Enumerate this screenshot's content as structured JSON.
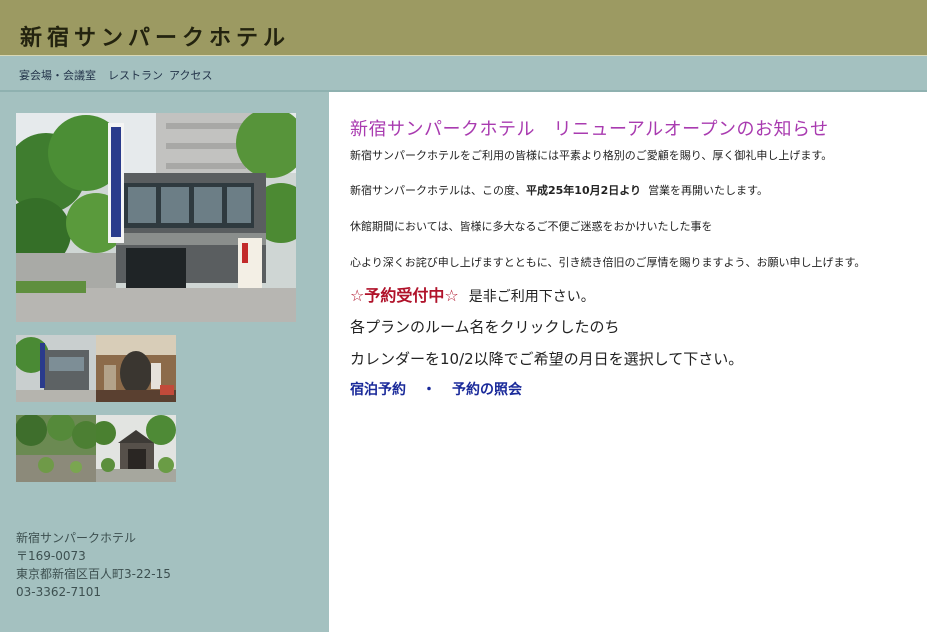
{
  "header": {
    "title": "新宿サンパークホテル"
  },
  "nav": {
    "items": [
      "宴会場・会議室",
      "レストラン",
      "アクセス"
    ]
  },
  "sidebar": {
    "address": {
      "name": "新宿サンパークホテル",
      "zip": "〒169-0073",
      "street": "東京都新宿区百人町3-22-15",
      "phone": "03-3362-7101"
    }
  },
  "main": {
    "title": "新宿サンパークホテル　リニューアルオープンのお知らせ",
    "p1": "新宿サンパークホテルをご利用の皆様には平素より格別のご愛顧を賜り、厚く御礼申し上げます。",
    "p2_pre": "新宿サンパークホテルは、この度、",
    "p2_bold": "平成25年10月2日より",
    "p2_post": "営業を再開いたします。",
    "p3": "休館期間においては、皆様に多大なるご不便ご迷惑をおかけいたした事を",
    "p4": "心より深くお詫び申し上げますとともに、引き続き倍旧のご厚情を賜りますよう、お願い申し上げます。",
    "reserve_badge": "☆予約受付中☆",
    "reserve_text": "是非ご利用下さい。",
    "line_a": "各プランのルーム名をクリックしたのち",
    "line_b": "カレンダーを10/2以降でご希望の月日を選択して下さい。",
    "link_booking": "宿泊予約",
    "link_sep": "・",
    "link_inquiry": "予約の照会"
  }
}
